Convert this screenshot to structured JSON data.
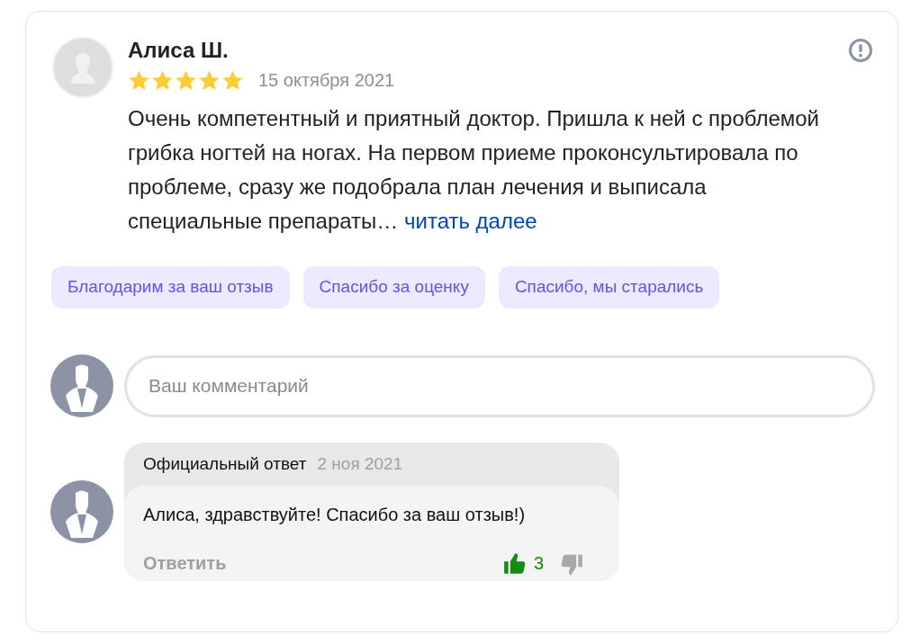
{
  "review": {
    "author": "Алиса Ш.",
    "stars": 5,
    "date": "15 октября 2021",
    "text": "Очень компетентный и приятный доктор. Пришла к ней с проблемой грибка ногтей на ногах. На первом приеме проконсультировала по проблеме, сразу же подобрала план лечения и выписала специальные препараты…",
    "read_more": "читать далее"
  },
  "quick_replies": [
    "Благодарим за ваш отзыв",
    "Спасибо за оценку",
    "Спасибо, мы старались"
  ],
  "comment_field": {
    "placeholder": "Ваш комментарий"
  },
  "official_reply": {
    "label": "Официальный ответ",
    "date": "2 ноя 2021",
    "text": "Алиса, здравствуйте! Спасибо за ваш отзыв!)",
    "reply_link": "Ответить",
    "likes": "3",
    "liked": true
  }
}
